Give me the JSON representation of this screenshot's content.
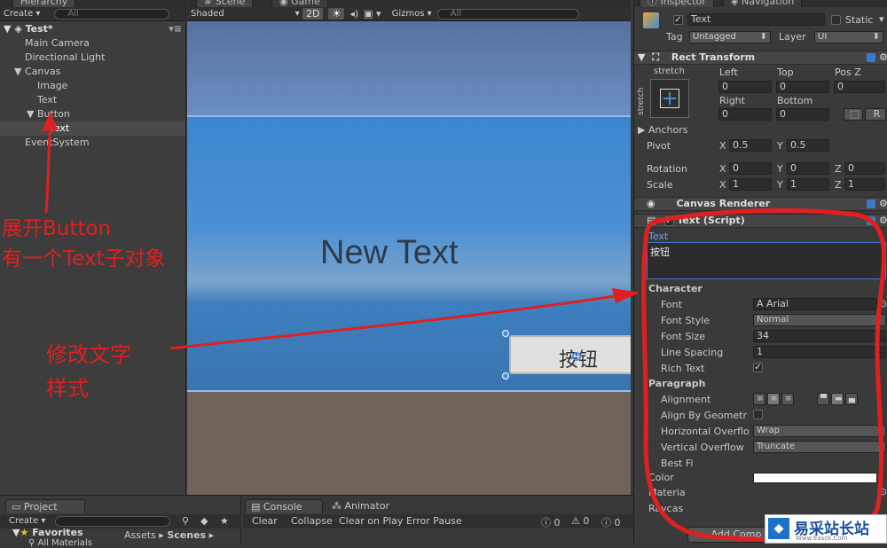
{
  "hierarchy": {
    "tab": "Hierarchy",
    "create": "Create",
    "search_placeholder": "All",
    "scene_name": "Test*",
    "items": [
      "Main Camera",
      "Directional Light",
      "Canvas",
      "Image",
      "Text",
      "Button",
      "Text",
      "EventSystem"
    ]
  },
  "scene": {
    "tabs": [
      "Scene",
      "Game"
    ],
    "shaded": "Shaded",
    "mode_2d": "2D",
    "gizmos": "Gizmos",
    "search_placeholder": "All",
    "new_text": "New Text",
    "button_text": "按钮"
  },
  "inspector": {
    "tabs": [
      "Inspector",
      "Navigation"
    ],
    "object_name": "Text",
    "static_label": "Static",
    "tag_label": "Tag",
    "tag_value": "Untagged",
    "layer_label": "Layer",
    "layer_value": "UI",
    "rect_transform": {
      "title": "Rect Transform",
      "stretch": "stretch",
      "stretch_side": "stretch",
      "left_label": "Left",
      "top_label": "Top",
      "posz_label": "Pos Z",
      "left": "0",
      "top": "0",
      "posz": "0",
      "right_label": "Right",
      "bottom_label": "Bottom",
      "right": "0",
      "bottom": "0",
      "r_button": "R",
      "anchors": "Anchors",
      "pivot_label": "Pivot",
      "pivot_x": "0.5",
      "pivot_y": "0.5",
      "rotation_label": "Rotation",
      "rot_x": "0",
      "rot_y": "0",
      "rot_z": "0",
      "scale_label": "Scale",
      "scale_x": "1",
      "scale_y": "1",
      "scale_z": "1",
      "x": "X",
      "y": "Y",
      "z": "Z"
    },
    "canvas_renderer": "Canvas Renderer",
    "text_script": {
      "title": "Text (Script)",
      "text_label": "Text",
      "text_value": "按钮",
      "character": "Character",
      "font_label": "Font",
      "font_value": "Arial",
      "font_style_label": "Font Style",
      "font_style_value": "Normal",
      "font_size_label": "Font Size",
      "font_size_value": "34",
      "line_spacing_label": "Line Spacing",
      "line_spacing_value": "1",
      "rich_text_label": "Rich Text",
      "paragraph": "Paragraph",
      "alignment_label": "Alignment",
      "align_geom_label": "Align By Geometr",
      "h_overflow_label": "Horizontal Overflo",
      "h_overflow_value": "Wrap",
      "v_overflow_label": "Vertical Overflow",
      "v_overflow_value": "Truncate",
      "best_fit_label": "Best Fi",
      "color_label": "Color",
      "material_label": "Materia",
      "raycast_label": "Raycas",
      "add_component": "Add Comp"
    }
  },
  "bottom": {
    "project_tab": "Project",
    "create": "Create",
    "favorites": "Favorites",
    "all_materials": "All Materials",
    "assets": "Assets",
    "scenes": "Scenes",
    "console_tab": "Console",
    "animator_tab": "Animator",
    "clear": "Clear",
    "collapse": "Collapse",
    "clear_on_play": "Clear on Play",
    "error_pause": "Error Pause",
    "count_log": "0",
    "count_warn": "0",
    "count_err": "0"
  },
  "annotations": {
    "expand_line1": "展开Button",
    "expand_line2": "有一个Text子对象",
    "modify_line1": "修改文字",
    "modify_line2": "样式"
  },
  "watermark": {
    "site": "易采站长站",
    "url": "Www.Easck.Com"
  },
  "colors": {
    "annotation": "#e02020",
    "sky_top": "#6c8fc0",
    "sky_mid": "#3f8ad0",
    "ground": "#6e6459"
  }
}
